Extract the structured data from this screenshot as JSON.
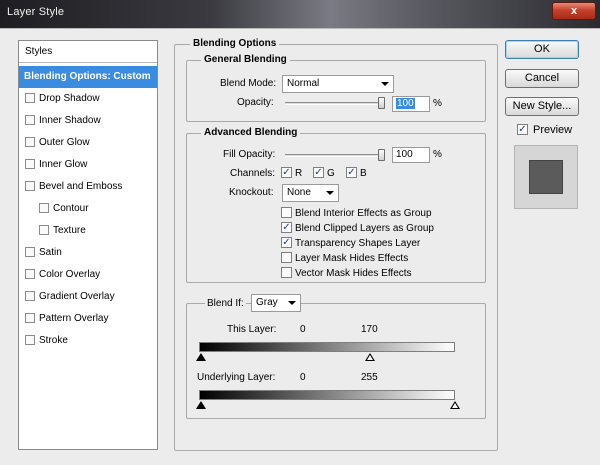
{
  "window": {
    "title": "Layer Style",
    "close_label": "x"
  },
  "styles_list": {
    "header": "Styles",
    "items": [
      {
        "label": "Blending Options: Custom",
        "selected": true,
        "checkbox": false
      },
      {
        "label": "Drop Shadow",
        "checkbox": true,
        "checked": false
      },
      {
        "label": "Inner Shadow",
        "checkbox": true,
        "checked": false
      },
      {
        "label": "Outer Glow",
        "checkbox": true,
        "checked": false
      },
      {
        "label": "Inner Glow",
        "checkbox": true,
        "checked": false
      },
      {
        "label": "Bevel and Emboss",
        "checkbox": true,
        "checked": false
      },
      {
        "label": "Contour",
        "checkbox": true,
        "checked": false,
        "sub": true
      },
      {
        "label": "Texture",
        "checkbox": true,
        "checked": false,
        "sub": true
      },
      {
        "label": "Satin",
        "checkbox": true,
        "checked": false
      },
      {
        "label": "Color Overlay",
        "checkbox": true,
        "checked": false
      },
      {
        "label": "Gradient Overlay",
        "checkbox": true,
        "checked": false
      },
      {
        "label": "Pattern Overlay",
        "checkbox": true,
        "checked": false
      },
      {
        "label": "Stroke",
        "checkbox": true,
        "checked": false
      }
    ]
  },
  "blending_options": {
    "title": "Blending Options",
    "general": {
      "title": "General Blending",
      "blend_mode_label": "Blend Mode:",
      "blend_mode_value": "Normal",
      "opacity_label": "Opacity:",
      "opacity_value": "100",
      "opacity_unit": "%",
      "opacity_level": 1.0
    },
    "advanced": {
      "title": "Advanced Blending",
      "fill_opacity_label": "Fill Opacity:",
      "fill_opacity_value": "100",
      "fill_opacity_unit": "%",
      "fill_opacity_level": 1.0,
      "channels_label": "Channels:",
      "channels": [
        {
          "label": "R",
          "checked": true
        },
        {
          "label": "G",
          "checked": true
        },
        {
          "label": "B",
          "checked": true
        }
      ],
      "knockout_label": "Knockout:",
      "knockout_value": "None",
      "options": [
        {
          "label": "Blend Interior Effects as Group",
          "checked": false
        },
        {
          "label": "Blend Clipped Layers as Group",
          "checked": true
        },
        {
          "label": "Transparency Shapes Layer",
          "checked": true
        },
        {
          "label": "Layer Mask Hides Effects",
          "checked": false
        },
        {
          "label": "Vector Mask Hides Effects",
          "checked": false
        }
      ]
    },
    "blend_if": {
      "label": "Blend If:",
      "value": "Gray",
      "this_layer_label": "This Layer:",
      "this_layer_low": "0",
      "this_layer_high": "170",
      "underlying_label": "Underlying Layer:",
      "underlying_low": "0",
      "underlying_high": "255"
    }
  },
  "buttons": {
    "ok": "OK",
    "cancel": "Cancel",
    "new_style": "New Style...",
    "preview_label": "Preview",
    "preview_checked": true
  },
  "colors": {
    "selection": "#3a8ce0",
    "preview_swatch": "#5b5b5b"
  }
}
